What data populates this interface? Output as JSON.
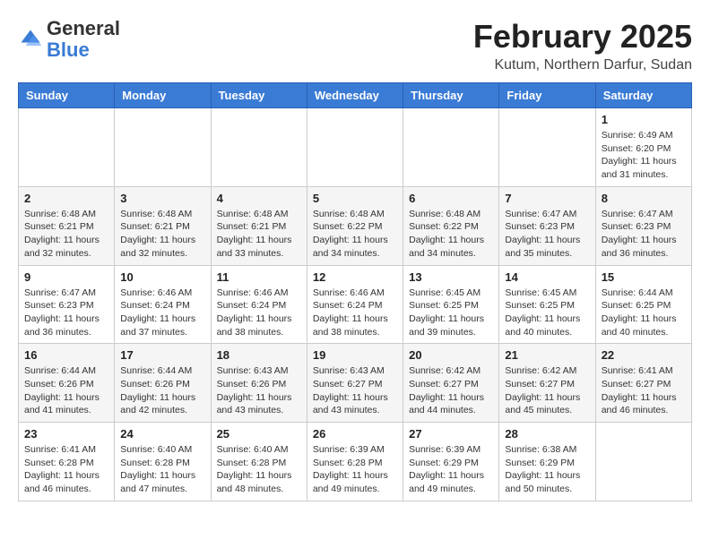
{
  "header": {
    "logo_general": "General",
    "logo_blue": "Blue",
    "month_title": "February 2025",
    "location": "Kutum, Northern Darfur, Sudan"
  },
  "weekdays": [
    "Sunday",
    "Monday",
    "Tuesday",
    "Wednesday",
    "Thursday",
    "Friday",
    "Saturday"
  ],
  "weeks": [
    [
      {
        "day": "",
        "info": ""
      },
      {
        "day": "",
        "info": ""
      },
      {
        "day": "",
        "info": ""
      },
      {
        "day": "",
        "info": ""
      },
      {
        "day": "",
        "info": ""
      },
      {
        "day": "",
        "info": ""
      },
      {
        "day": "1",
        "info": "Sunrise: 6:49 AM\nSunset: 6:20 PM\nDaylight: 11 hours\nand 31 minutes."
      }
    ],
    [
      {
        "day": "2",
        "info": "Sunrise: 6:48 AM\nSunset: 6:21 PM\nDaylight: 11 hours\nand 32 minutes."
      },
      {
        "day": "3",
        "info": "Sunrise: 6:48 AM\nSunset: 6:21 PM\nDaylight: 11 hours\nand 32 minutes."
      },
      {
        "day": "4",
        "info": "Sunrise: 6:48 AM\nSunset: 6:21 PM\nDaylight: 11 hours\nand 33 minutes."
      },
      {
        "day": "5",
        "info": "Sunrise: 6:48 AM\nSunset: 6:22 PM\nDaylight: 11 hours\nand 34 minutes."
      },
      {
        "day": "6",
        "info": "Sunrise: 6:48 AM\nSunset: 6:22 PM\nDaylight: 11 hours\nand 34 minutes."
      },
      {
        "day": "7",
        "info": "Sunrise: 6:47 AM\nSunset: 6:23 PM\nDaylight: 11 hours\nand 35 minutes."
      },
      {
        "day": "8",
        "info": "Sunrise: 6:47 AM\nSunset: 6:23 PM\nDaylight: 11 hours\nand 36 minutes."
      }
    ],
    [
      {
        "day": "9",
        "info": "Sunrise: 6:47 AM\nSunset: 6:23 PM\nDaylight: 11 hours\nand 36 minutes."
      },
      {
        "day": "10",
        "info": "Sunrise: 6:46 AM\nSunset: 6:24 PM\nDaylight: 11 hours\nand 37 minutes."
      },
      {
        "day": "11",
        "info": "Sunrise: 6:46 AM\nSunset: 6:24 PM\nDaylight: 11 hours\nand 38 minutes."
      },
      {
        "day": "12",
        "info": "Sunrise: 6:46 AM\nSunset: 6:24 PM\nDaylight: 11 hours\nand 38 minutes."
      },
      {
        "day": "13",
        "info": "Sunrise: 6:45 AM\nSunset: 6:25 PM\nDaylight: 11 hours\nand 39 minutes."
      },
      {
        "day": "14",
        "info": "Sunrise: 6:45 AM\nSunset: 6:25 PM\nDaylight: 11 hours\nand 40 minutes."
      },
      {
        "day": "15",
        "info": "Sunrise: 6:44 AM\nSunset: 6:25 PM\nDaylight: 11 hours\nand 40 minutes."
      }
    ],
    [
      {
        "day": "16",
        "info": "Sunrise: 6:44 AM\nSunset: 6:26 PM\nDaylight: 11 hours\nand 41 minutes."
      },
      {
        "day": "17",
        "info": "Sunrise: 6:44 AM\nSunset: 6:26 PM\nDaylight: 11 hours\nand 42 minutes."
      },
      {
        "day": "18",
        "info": "Sunrise: 6:43 AM\nSunset: 6:26 PM\nDaylight: 11 hours\nand 43 minutes."
      },
      {
        "day": "19",
        "info": "Sunrise: 6:43 AM\nSunset: 6:27 PM\nDaylight: 11 hours\nand 43 minutes."
      },
      {
        "day": "20",
        "info": "Sunrise: 6:42 AM\nSunset: 6:27 PM\nDaylight: 11 hours\nand 44 minutes."
      },
      {
        "day": "21",
        "info": "Sunrise: 6:42 AM\nSunset: 6:27 PM\nDaylight: 11 hours\nand 45 minutes."
      },
      {
        "day": "22",
        "info": "Sunrise: 6:41 AM\nSunset: 6:27 PM\nDaylight: 11 hours\nand 46 minutes."
      }
    ],
    [
      {
        "day": "23",
        "info": "Sunrise: 6:41 AM\nSunset: 6:28 PM\nDaylight: 11 hours\nand 46 minutes."
      },
      {
        "day": "24",
        "info": "Sunrise: 6:40 AM\nSunset: 6:28 PM\nDaylight: 11 hours\nand 47 minutes."
      },
      {
        "day": "25",
        "info": "Sunrise: 6:40 AM\nSunset: 6:28 PM\nDaylight: 11 hours\nand 48 minutes."
      },
      {
        "day": "26",
        "info": "Sunrise: 6:39 AM\nSunset: 6:28 PM\nDaylight: 11 hours\nand 49 minutes."
      },
      {
        "day": "27",
        "info": "Sunrise: 6:39 AM\nSunset: 6:29 PM\nDaylight: 11 hours\nand 49 minutes."
      },
      {
        "day": "28",
        "info": "Sunrise: 6:38 AM\nSunset: 6:29 PM\nDaylight: 11 hours\nand 50 minutes."
      },
      {
        "day": "",
        "info": ""
      }
    ]
  ]
}
